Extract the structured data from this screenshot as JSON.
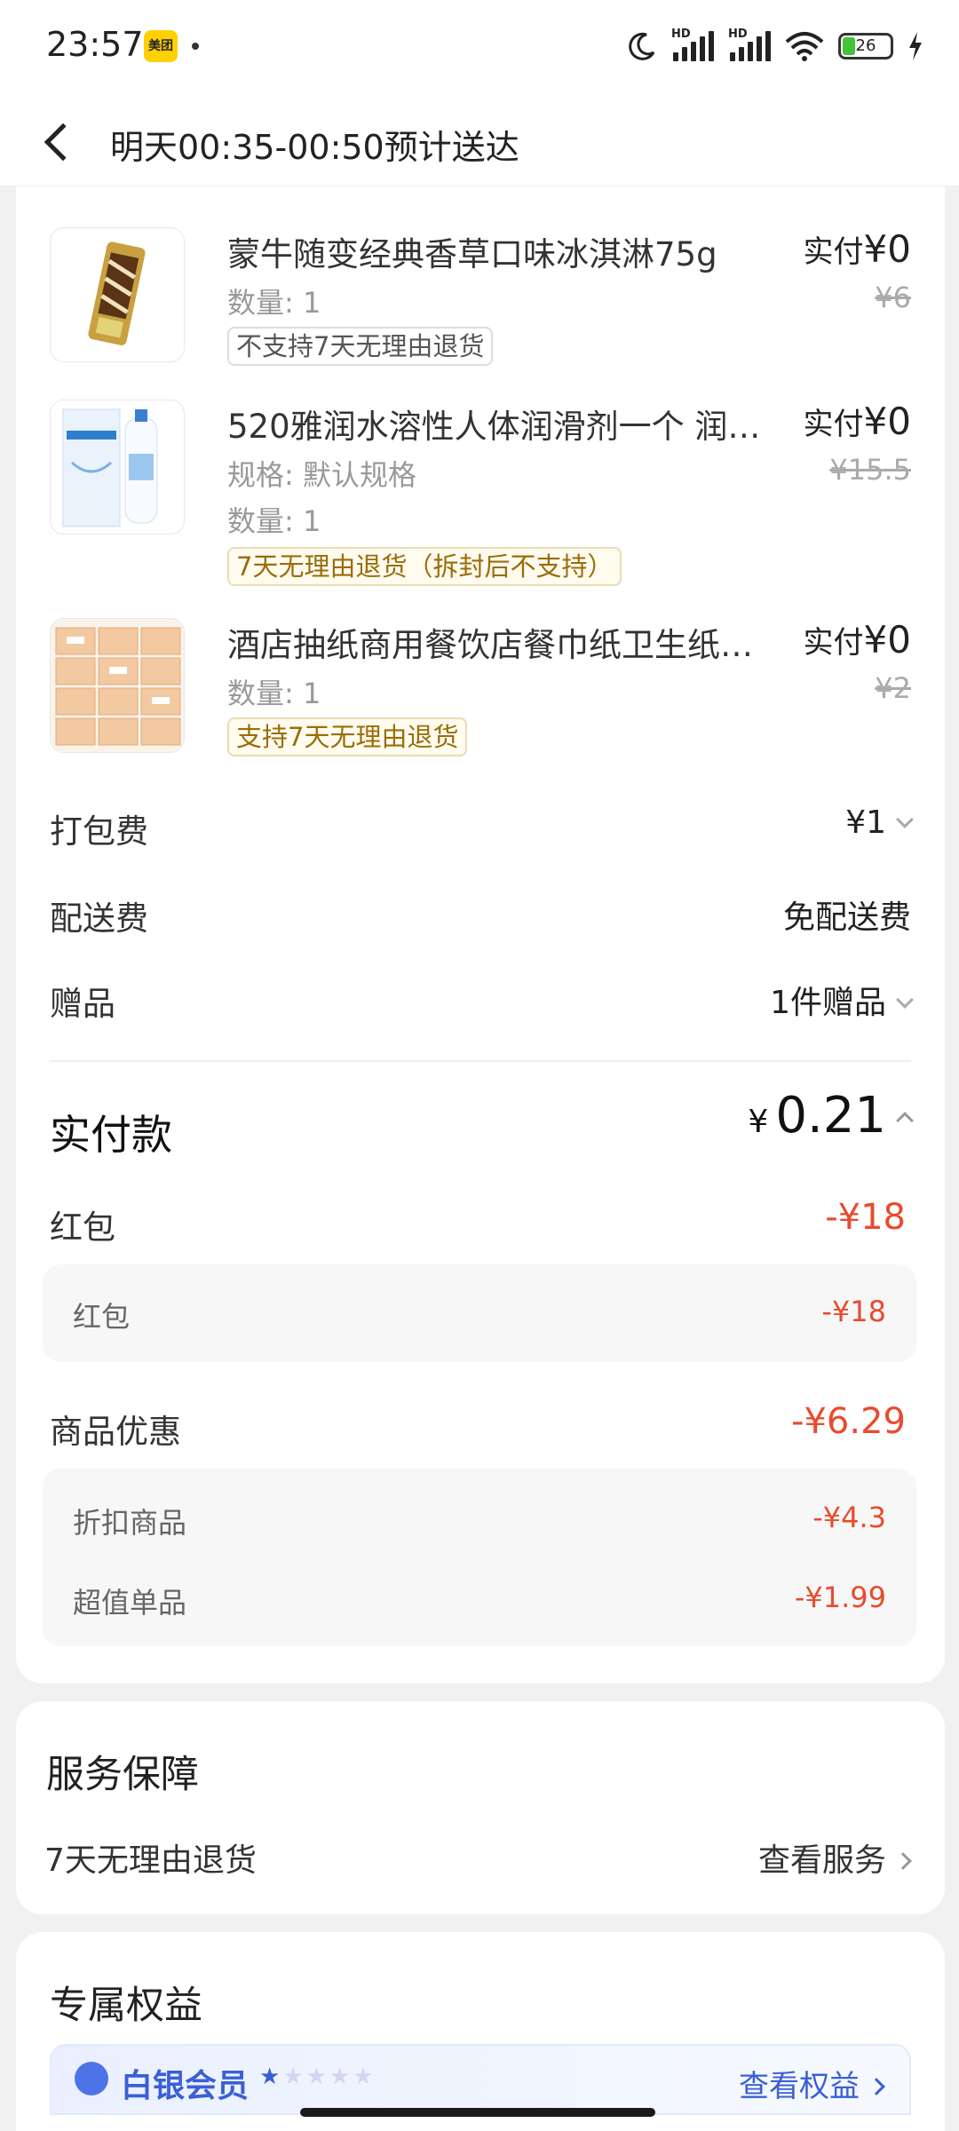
{
  "status_bar": {
    "time": "23:57",
    "app_badge": "美团",
    "signal_label": "HD",
    "battery": "26"
  },
  "header": {
    "title": "明天00:35-00:50预计送达"
  },
  "items": [
    {
      "title": "蒙牛随变经典香草口味冰淇淋75g",
      "spec": "",
      "quantity": "数量: 1",
      "tag": "不支持7天无理由退货",
      "paid_label": "实付",
      "paid_value": "¥0",
      "original_price": "¥6"
    },
    {
      "title": "520雅润水溶性人体润滑剂一个 润…",
      "spec": "规格: 默认规格",
      "quantity": "数量: 1",
      "tag": "7天无理由退货（拆封后不支持）",
      "paid_label": "实付",
      "paid_value": "¥0",
      "original_price": "¥15.5"
    },
    {
      "title": "酒店抽纸商用餐饮店餐巾纸卫生纸…",
      "spec": "",
      "quantity": "数量: 1",
      "tag": "支持7天无理由退货",
      "paid_label": "实付",
      "paid_value": "¥0",
      "original_price": "¥2"
    }
  ],
  "fees": {
    "packing": {
      "label": "打包费",
      "value": "¥1"
    },
    "delivery": {
      "label": "配送费",
      "value": "免配送费"
    },
    "gift": {
      "label": "赠品",
      "value": "1件赠品"
    }
  },
  "total": {
    "label": "实付款",
    "currency": "¥",
    "amount": "0.21"
  },
  "red_packet": {
    "label": "红包",
    "value": "-¥18",
    "detail": [
      {
        "label": "红包",
        "value": "-¥18"
      }
    ]
  },
  "product_discount": {
    "label": "商品优惠",
    "value": "-¥6.29",
    "detail": [
      {
        "label": "折扣商品",
        "value": "-¥4.3"
      },
      {
        "label": "超值单品",
        "value": "-¥1.99"
      }
    ]
  },
  "service": {
    "title": "服务保障",
    "row_label": "7天无理由退货",
    "row_action": "查看服务"
  },
  "perks": {
    "title": "专属权益",
    "member_name": "白银会员",
    "stars_on": "★",
    "stars_off": "★★★★",
    "action": "查看权益"
  },
  "colors": {
    "accent_red": "#e84b2f",
    "gold_tag": "#9a6d08",
    "member_blue": "#3b5fd6"
  }
}
